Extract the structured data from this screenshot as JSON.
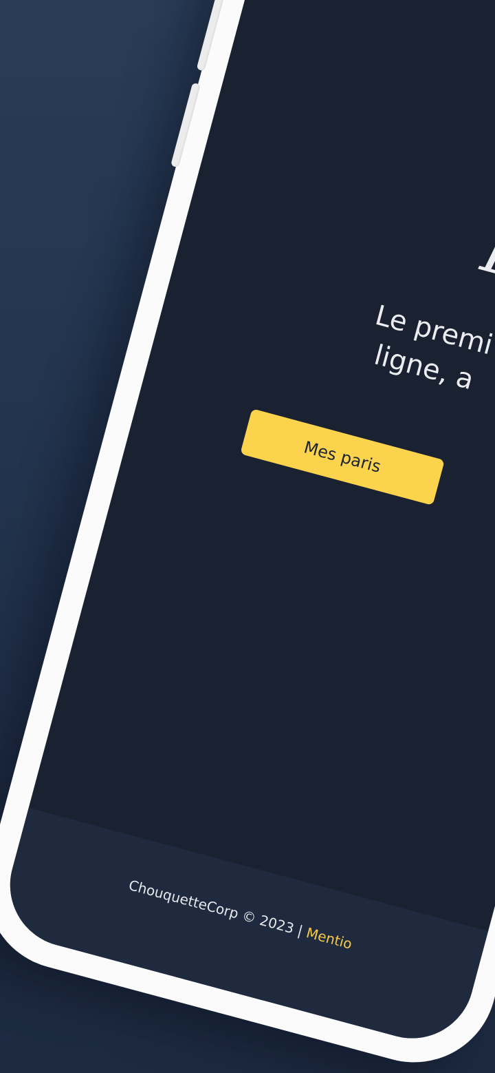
{
  "header": {
    "menu_icon": "hamburger-menu-icon"
  },
  "hero": {
    "logo": "B",
    "tagline_line1": "Le premi",
    "tagline_line2": "ligne, a",
    "cta_label": "Mes paris"
  },
  "footer": {
    "copyright": "ChouquetteCorp © 2023 | ",
    "link_label": "Mentio"
  },
  "colors": {
    "background": "#22334d",
    "screen": "#1a2232",
    "accent": "#fcd34d",
    "frame": "#fbfbfb",
    "footer": "#1f2a3f"
  }
}
